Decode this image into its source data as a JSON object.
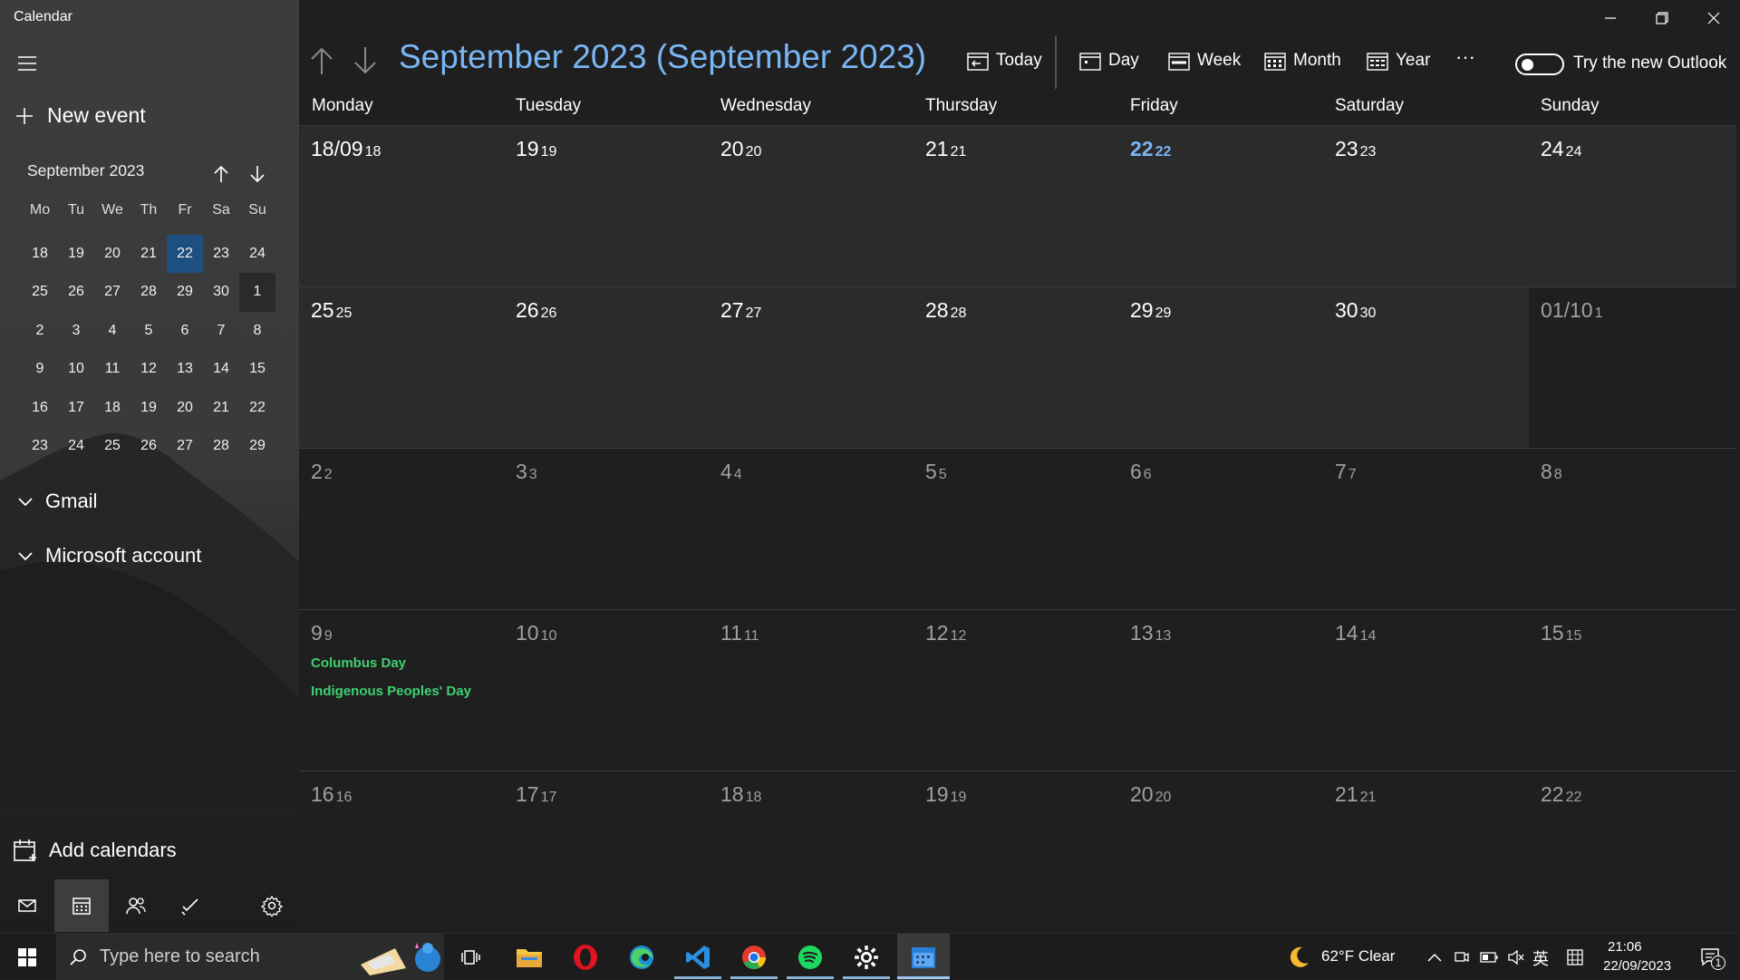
{
  "app": {
    "title": "Calendar"
  },
  "sidebar": {
    "new_event": "New event",
    "mini_calendar": {
      "title": "September 2023",
      "weekdays": [
        "Mo",
        "Tu",
        "We",
        "Th",
        "Fr",
        "Sa",
        "Su"
      ],
      "weeks": [
        [
          "18",
          "19",
          "20",
          "21",
          "22",
          "23",
          "24"
        ],
        [
          "25",
          "26",
          "27",
          "28",
          "29",
          "30",
          "1"
        ],
        [
          "2",
          "3",
          "4",
          "5",
          "6",
          "7",
          "8"
        ],
        [
          "9",
          "10",
          "11",
          "12",
          "13",
          "14",
          "15"
        ],
        [
          "16",
          "17",
          "18",
          "19",
          "20",
          "21",
          "22"
        ],
        [
          "23",
          "24",
          "25",
          "26",
          "27",
          "28",
          "29"
        ]
      ]
    },
    "accounts": [
      "Gmail",
      "Microsoft account"
    ],
    "add_calendars": "Add calendars"
  },
  "header": {
    "month_title": "September 2023 (September 2023)",
    "today": "Today",
    "day": "Day",
    "week": "Week",
    "month": "Month",
    "year": "Year",
    "more": "···",
    "toggle_label": "Try the new Outlook"
  },
  "grid": {
    "weekdays": [
      "Monday",
      "Tuesday",
      "Wednesday",
      "Thursday",
      "Friday",
      "Saturday",
      "Sunday"
    ],
    "weeks": [
      [
        {
          "big": "18/09",
          "small": "18"
        },
        {
          "big": "19",
          "small": "19"
        },
        {
          "big": "20",
          "small": "20"
        },
        {
          "big": "21",
          "small": "21"
        },
        {
          "big": "22",
          "small": "22"
        },
        {
          "big": "23",
          "small": "23"
        },
        {
          "big": "24",
          "small": "24"
        }
      ],
      [
        {
          "big": "25",
          "small": "25"
        },
        {
          "big": "26",
          "small": "26"
        },
        {
          "big": "27",
          "small": "27"
        },
        {
          "big": "28",
          "small": "28"
        },
        {
          "big": "29",
          "small": "29"
        },
        {
          "big": "30",
          "small": "30"
        },
        {
          "big": "01/10",
          "small": "1"
        }
      ],
      [
        {
          "big": "2",
          "small": "2"
        },
        {
          "big": "3",
          "small": "3"
        },
        {
          "big": "4",
          "small": "4"
        },
        {
          "big": "5",
          "small": "5"
        },
        {
          "big": "6",
          "small": "6"
        },
        {
          "big": "7",
          "small": "7"
        },
        {
          "big": "8",
          "small": "8"
        }
      ],
      [
        {
          "big": "9",
          "small": "9",
          "events": [
            "Columbus Day",
            "Indigenous Peoples' Day"
          ]
        },
        {
          "big": "10",
          "small": "10"
        },
        {
          "big": "11",
          "small": "11"
        },
        {
          "big": "12",
          "small": "12"
        },
        {
          "big": "13",
          "small": "13"
        },
        {
          "big": "14",
          "small": "14"
        },
        {
          "big": "15",
          "small": "15"
        }
      ],
      [
        {
          "big": "16",
          "small": "16"
        },
        {
          "big": "17",
          "small": "17"
        },
        {
          "big": "18",
          "small": "18"
        },
        {
          "big": "19",
          "small": "19"
        },
        {
          "big": "20",
          "small": "20"
        },
        {
          "big": "21",
          "small": "21"
        },
        {
          "big": "22",
          "small": "22"
        }
      ]
    ]
  },
  "taskbar": {
    "search_placeholder": "Type here to search",
    "weather": "62°F  Clear",
    "ime": "英",
    "time": "21:06",
    "date": "22/09/2023",
    "notification_count": "1"
  },
  "colors": {
    "accent": "#7ab6f3",
    "today_bg": "#1d4f80",
    "event": "#3fd071"
  }
}
